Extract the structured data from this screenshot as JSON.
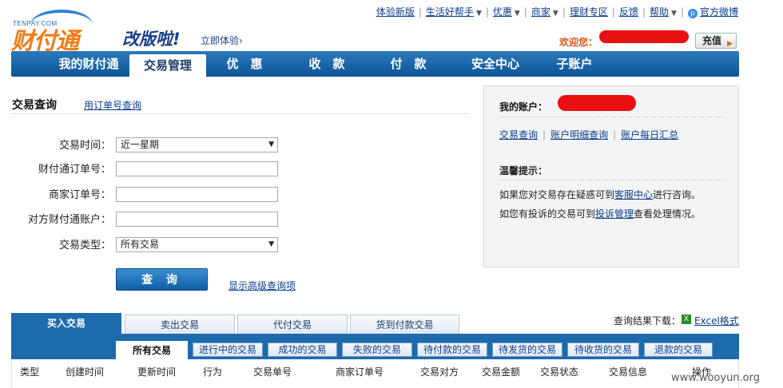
{
  "top_links": [
    {
      "label": "体验新版",
      "caret": false
    },
    {
      "label": "生活好帮手",
      "caret": true
    },
    {
      "label": "优惠",
      "caret": true
    },
    {
      "label": "商家",
      "caret": true
    },
    {
      "label": "理财专区",
      "caret": false
    },
    {
      "label": "反馈",
      "caret": false
    },
    {
      "label": "帮助",
      "caret": true
    },
    {
      "label": "官方微博",
      "caret": false,
      "icon": "weibo-icon"
    }
  ],
  "logo": {
    "small": "TENPAY.COM",
    "text": "财付通"
  },
  "slogan": "改版啦!",
  "try_label": "立即体验",
  "welcome": "欢迎您：",
  "recharge_label": "充值",
  "nav": [
    "我的财付通",
    "交易管理",
    "优　惠",
    "收　款",
    "付　款",
    "安全中心",
    "子账户"
  ],
  "query": {
    "title": "交易查询",
    "order_link": "用订单号查询",
    "fields": [
      {
        "label": "交易时间：",
        "type": "select",
        "value": "近一星期"
      },
      {
        "label": "财付通订单号：",
        "type": "input",
        "value": ""
      },
      {
        "label": "商家订单号：",
        "type": "input",
        "value": ""
      },
      {
        "label": "对方财付通账户：",
        "type": "input",
        "value": ""
      },
      {
        "label": "交易类型：",
        "type": "select",
        "value": "所有交易"
      }
    ],
    "button": "查 询",
    "advanced_link": "显示高级查询项"
  },
  "panel": {
    "account_label": "我的账户：",
    "links": [
      "交易查询",
      "账户明细查询",
      "账户每日汇总"
    ],
    "tip_title": "温馨提示：",
    "tip1_pre": "如果您对交易存在疑惑可到",
    "tip1_link": "客服中心",
    "tip1_post": "进行咨询。",
    "tip2_pre": "如您有投诉的交易可到",
    "tip2_link": "投诉管理",
    "tip2_post": "查看处理情况。"
  },
  "main_tabs": [
    "买入交易",
    "卖出交易",
    "代付交易",
    "货到付款交易"
  ],
  "export_label": "查询结果下载：",
  "excel_link": "Excel格式",
  "sub_tabs": [
    "所有交易",
    "进行中的交易",
    "成功的交易",
    "失败的交易",
    "待付款的交易",
    "待发货的交易",
    "待收货的交易",
    "退款的交易"
  ],
  "columns": [
    "类型",
    "创建时间",
    "更新时间",
    "行为",
    "交易单号",
    "商家订单号",
    "交易对方",
    "交易金额",
    "交易状态",
    "交易信息",
    "操作"
  ],
  "watermark": "www.wooyun.org",
  "colors": {
    "nav_blue": "#1d6aad",
    "accent_orange": "#f27c14",
    "redaction": "#e81010"
  }
}
